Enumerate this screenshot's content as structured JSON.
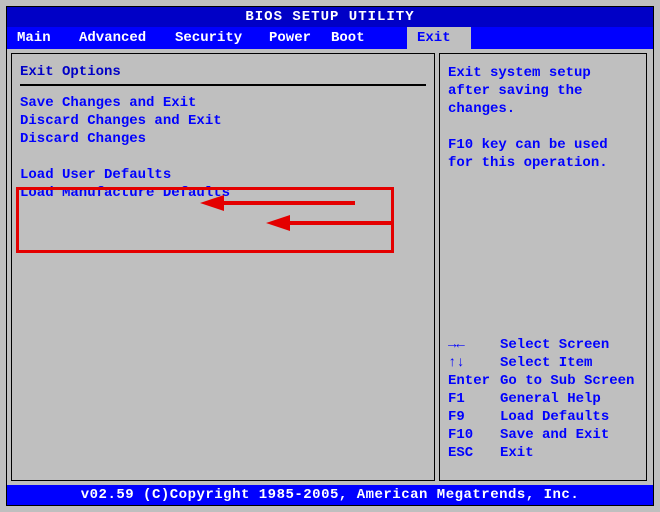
{
  "title": "BIOS SETUP UTILITY",
  "tabs": {
    "main": "Main",
    "advanced": "Advanced",
    "security": "Security",
    "power": "Power",
    "boot": "Boot",
    "exit": "Exit"
  },
  "left": {
    "heading": "Exit Options",
    "items": {
      "save_exit": "Save Changes and Exit",
      "discard_exit": "Discard Changes and Exit",
      "discard": "Discard Changes",
      "load_user": "Load User Defaults",
      "load_mfg": "Load Manufacture Defaults"
    }
  },
  "right": {
    "help1": "Exit system setup after saving the changes.",
    "help2": "F10 key can be used for this operation.",
    "nav": {
      "screen_key": "→←",
      "screen_lbl": "Select Screen",
      "item_key": "↑↓",
      "item_lbl": "Select Item",
      "enter_key": "Enter",
      "enter_lbl": "Go to Sub Screen",
      "f1_key": "F1",
      "f1_lbl": "General Help",
      "f9_key": "F9",
      "f9_lbl": "Load Defaults",
      "f10_key": "F10",
      "f10_lbl": "Save and Exit",
      "esc_key": "ESC",
      "esc_lbl": "Exit"
    }
  },
  "footer": "v02.59 (C)Copyright 1985-2005, American Megatrends, Inc."
}
